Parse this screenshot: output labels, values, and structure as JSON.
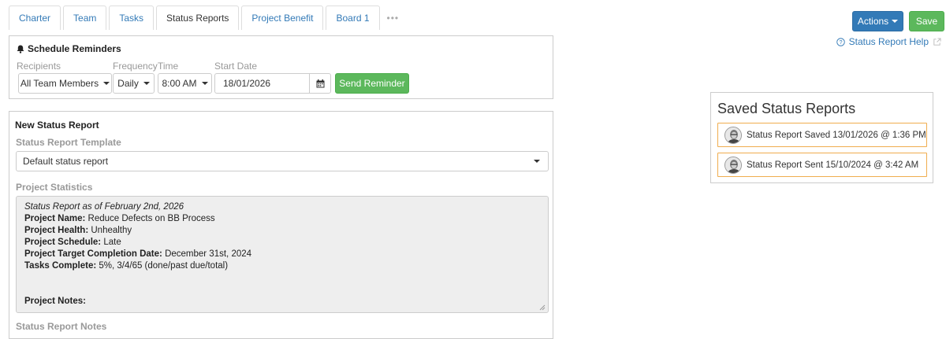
{
  "tabs": [
    {
      "label": "Charter",
      "active": false
    },
    {
      "label": "Team",
      "active": false
    },
    {
      "label": "Tasks",
      "active": false
    },
    {
      "label": "Status Reports",
      "active": true
    },
    {
      "label": "Project Benefit",
      "active": false
    },
    {
      "label": "Board 1",
      "active": false
    }
  ],
  "tabs_more": "•••",
  "toolbar": {
    "actions_label": "Actions",
    "save_label": "Save",
    "help_label": "Status Report Help"
  },
  "reminders": {
    "title": "Schedule Reminders",
    "recipients_label": "Recipients",
    "frequency_label": "Frequency",
    "time_label": "Time",
    "start_date_label": "Start Date",
    "recipients_value": "All Team Members",
    "frequency_value": "Daily",
    "time_value": "8:00 AM",
    "start_date_value": "18/01/2026",
    "send_label": "Send Reminder"
  },
  "new_report": {
    "title": "New Status Report",
    "template_label": "Status Report Template",
    "template_value": "Default status report",
    "stats_label": "Project Statistics",
    "stats": {
      "as_of": "Status Report as of February 2nd, 2026",
      "name_key": "Project Name:",
      "name_val": " Reduce Defects on BB Process",
      "health_key": "Project Health:",
      "health_val": " Unhealthy",
      "schedule_key": "Project Schedule:",
      "schedule_val": " Late",
      "target_key": "Project Target Completion Date:",
      "target_val": " December 31st, 2024",
      "tasks_key": "Tasks Complete:",
      "tasks_val": " 5%, 3/4/65 (done/past due/total)",
      "notes_key": "Project Notes:"
    },
    "notes_label": "Status Report Notes"
  },
  "saved": {
    "title": "Saved Status Reports",
    "items": [
      {
        "text": "Status Report Saved 13/01/2026 @ 1:36 PM"
      },
      {
        "text": "Status Report Sent 15/10/2024 @ 3:42 AM"
      }
    ]
  },
  "colors": {
    "primary": "#337ab7",
    "success": "#5cb85c",
    "warning_border": "#f0ad4e"
  }
}
